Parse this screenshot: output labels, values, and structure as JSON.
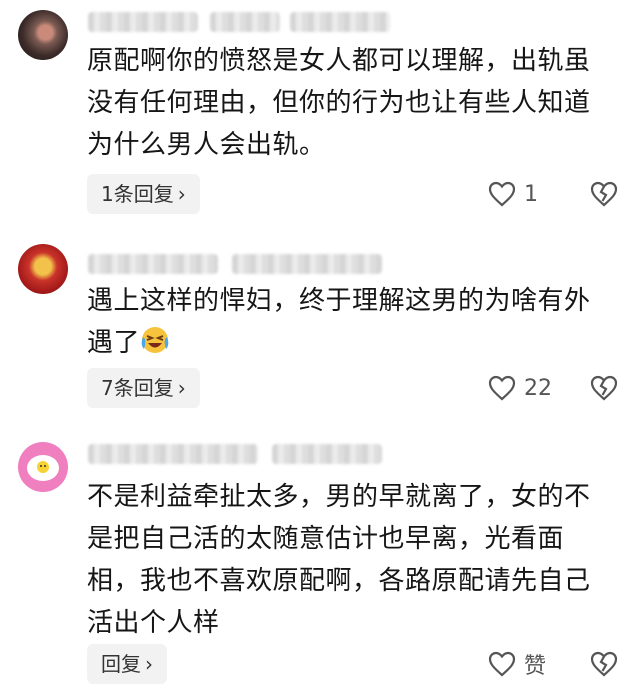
{
  "comments": [
    {
      "text": "原配啊你的愤怒是女人都可以理解，出轨虽\n没有任何理由，但你的行为也让有些人知道\n为什么男人会出轨。",
      "reply_label": "1条回复",
      "like_count": "1",
      "avatar": "dark-avatar"
    },
    {
      "text": "遇上这样的悍妇，终于理解这男的为啥有外\n遇了",
      "reply_label": "7条回复",
      "like_count": "22",
      "avatar": "red-gold-avatar",
      "emoji": "laughing-crying-emoji"
    },
    {
      "text": "不是利益牵扯太多，男的早就离了，女的不\n是把自己活的太随意估计也早离，光看面\n相，我也不喜欢原配啊，各路原配请先自己\n活出个人样",
      "reply_label": "回复",
      "like_count": "赞",
      "avatar": "pink-egg-avatar"
    }
  ],
  "icons": {
    "chevron": "chevron-right-icon",
    "like": "heart-outline-icon",
    "dislike": "broken-heart-icon"
  }
}
